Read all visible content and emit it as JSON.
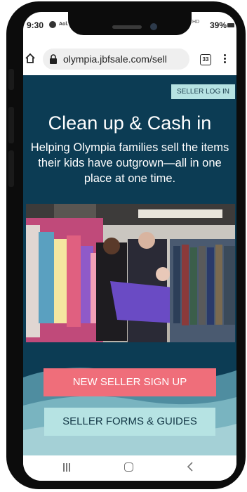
{
  "status_bar": {
    "time": "9:30",
    "notification": "Aol.",
    "signal": "HD",
    "battery": "39%"
  },
  "browser": {
    "url": "olympia.jbfsale.com/sell",
    "tab_count": "33"
  },
  "page": {
    "seller_login": "SELLER LOG IN",
    "headline": "Clean up & Cash in",
    "subhead": "Helping Olympia families sell the items their kids have outgrown—all in one place at one time.",
    "new_seller_button": "NEW SELLER SIGN UP",
    "forms_button": "SELLER FORMS & GUIDES"
  },
  "colors": {
    "page_bg": "#0c3c54",
    "pink_button": "#ef6e7a",
    "teal_button": "#b6e3e3"
  },
  "icons": {
    "home": "home-icon",
    "lock": "lock-icon",
    "tabs": "tabs-icon",
    "menu": "more-vert-icon",
    "nav_recent": "recent-apps-icon",
    "nav_home": "home-nav-icon",
    "nav_back": "back-icon"
  }
}
